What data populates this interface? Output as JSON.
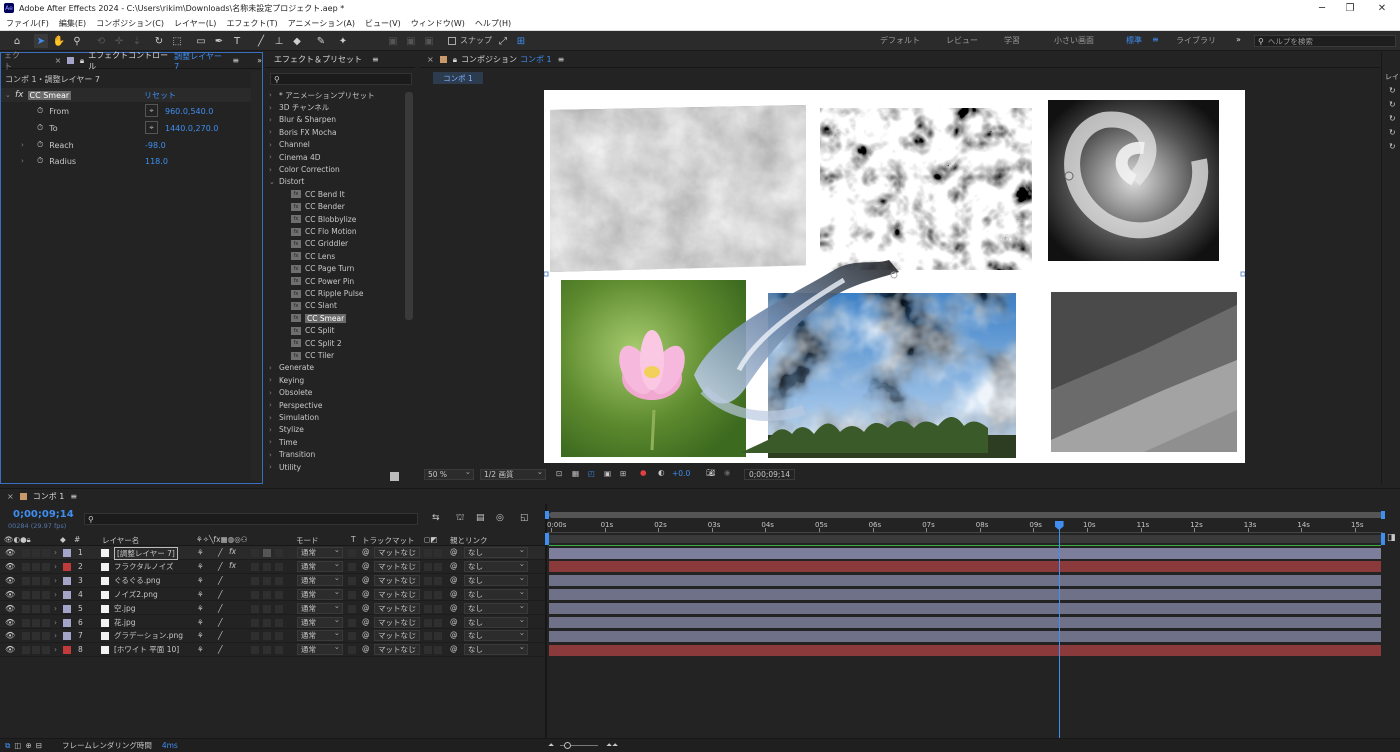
{
  "window": {
    "title": "Adobe After Effects 2024 - C:\\Users\\rikim\\Downloads\\名称未設定プロジェクト.aep *",
    "app_badge": "Ae",
    "controls": [
      "─",
      "❐",
      "✕"
    ]
  },
  "menu": [
    "ファイル(F)",
    "編集(E)",
    "コンポジション(C)",
    "レイヤー(L)",
    "エフェクト(T)",
    "アニメーション(A)",
    "ビュー(V)",
    "ウィンドウ(W)",
    "ヘルプ(H)"
  ],
  "toolbar": {
    "snap_label": "スナップ",
    "workspaces": [
      "デフォルト",
      "レビュー",
      "学習",
      "小さい画面",
      "標準",
      "ライブラリ"
    ],
    "active_workspace": "標準",
    "help_placeholder": "ヘルプを検索"
  },
  "effect_controls": {
    "left_tab_fragment": "ェクト",
    "tab_prefix": "エフェクトコントロール",
    "tab_layer": "調整レイヤー 7",
    "breadcrumb": "コンポ 1・調整レイヤー 7",
    "effect_name": "CC Smear",
    "reset_label": "リセット",
    "params": [
      {
        "name": "From",
        "value": "960.0,540.0",
        "has_point": true
      },
      {
        "name": "To",
        "value": "1440.0,270.0",
        "has_point": true
      },
      {
        "name": "Reach",
        "value": "-98.0",
        "has_point": false
      },
      {
        "name": "Radius",
        "value": "118.0",
        "has_point": false
      }
    ]
  },
  "effects_presets": {
    "title": "エフェクト＆プリセット",
    "search_value": "",
    "categories_top": [
      "* アニメーションプリセット",
      "3D チャンネル",
      "Blur & Sharpen",
      "Boris FX Mocha",
      "Channel",
      "Cinema 4D",
      "Color Correction"
    ],
    "distort_label": "Distort",
    "distort_items": [
      "CC Bend It",
      "CC Bender",
      "CC Blobbylize",
      "CC Flo Motion",
      "CC Griddler",
      "CC Lens",
      "CC Page Turn",
      "CC Power Pin",
      "CC Ripple Pulse",
      "CC Slant",
      "CC Smear",
      "CC Split",
      "CC Split 2",
      "CC Tiler"
    ],
    "selected_item": "CC Smear",
    "categories_bottom": [
      "Generate",
      "Keying",
      "Obsolete",
      "Perspective",
      "Simulation",
      "Stylize",
      "Time",
      "Transition",
      "Utility"
    ]
  },
  "composition": {
    "tab_prefix": "コンポジション",
    "tab_name": "コンポ 1",
    "sub_tab": "コンポ 1",
    "zoom": "50 %",
    "resolution": "1/2 画質",
    "exposure": "+0.0",
    "timecode": "0;00;09;14"
  },
  "timeline": {
    "tab": "コンポ 1",
    "timecode": "0;00;09;14",
    "frame_info": "00284 (29.97 fps)",
    "search_placeholder": "",
    "columns": {
      "layer_name": "レイヤー名",
      "mode": "モード",
      "trackmatte_t": "T",
      "trackmatte": "トラックマット",
      "parent": "親とリンク"
    },
    "ruler": [
      "0:00s",
      "01s",
      "02s",
      "03s",
      "04s",
      "05s",
      "06s",
      "07s",
      "08s",
      "09s",
      "10s",
      "11s",
      "12s",
      "13s",
      "14s",
      "15s"
    ],
    "playhead_seconds": 9.47,
    "duration_seconds": 15.6,
    "layers": [
      {
        "num": "1",
        "name": "[調整レイヤー 7]",
        "label_color": "#a4a4c8",
        "mode": "通常",
        "matte": "マットなし",
        "parent": "なし",
        "bar_color": "#7c7e9c",
        "selected_name": true,
        "has_fx": true
      },
      {
        "num": "2",
        "name": "フラクタルノイズ",
        "label_color": "#c03c3c",
        "mode": "通常",
        "matte": "マットなし",
        "parent": "なし",
        "bar_color": "#8a3a3a",
        "selected_name": false,
        "has_fx": true
      },
      {
        "num": "3",
        "name": "ぐるぐる.png",
        "label_color": "#a4a4c8",
        "mode": "通常",
        "matte": "マットなし",
        "parent": "なし",
        "bar_color": "#6f7189",
        "selected_name": false,
        "has_fx": false
      },
      {
        "num": "4",
        "name": "ノイズ2.png",
        "label_color": "#a4a4c8",
        "mode": "通常",
        "matte": "マットなし",
        "parent": "なし",
        "bar_color": "#6f7189",
        "selected_name": false,
        "has_fx": false
      },
      {
        "num": "5",
        "name": "空.jpg",
        "label_color": "#a4a4c8",
        "mode": "通常",
        "matte": "マットなし",
        "parent": "なし",
        "bar_color": "#6f7189",
        "selected_name": false,
        "has_fx": false
      },
      {
        "num": "6",
        "name": "花.jpg",
        "label_color": "#a4a4c8",
        "mode": "通常",
        "matte": "マットなし",
        "parent": "なし",
        "bar_color": "#6f7189",
        "selected_name": false,
        "has_fx": false
      },
      {
        "num": "7",
        "name": "グラデーション.png",
        "label_color": "#a4a4c8",
        "mode": "通常",
        "matte": "マットなし",
        "parent": "なし",
        "bar_color": "#6f7189",
        "selected_name": false,
        "has_fx": false
      },
      {
        "num": "8",
        "name": "[ホワイト 平面 10]",
        "label_color": "#c03c3c",
        "mode": "通常",
        "matte": "マットなし",
        "parent": "なし",
        "bar_color": "#8a3a3a",
        "selected_name": false,
        "has_fx": false
      }
    ]
  },
  "statusbar": {
    "render_label": "フレームレンダリング時間",
    "render_time": "4ms"
  },
  "colors": {
    "accent": "#3f8ef0",
    "panel_bg": "#232323",
    "work_area": "#3a3a3a"
  }
}
